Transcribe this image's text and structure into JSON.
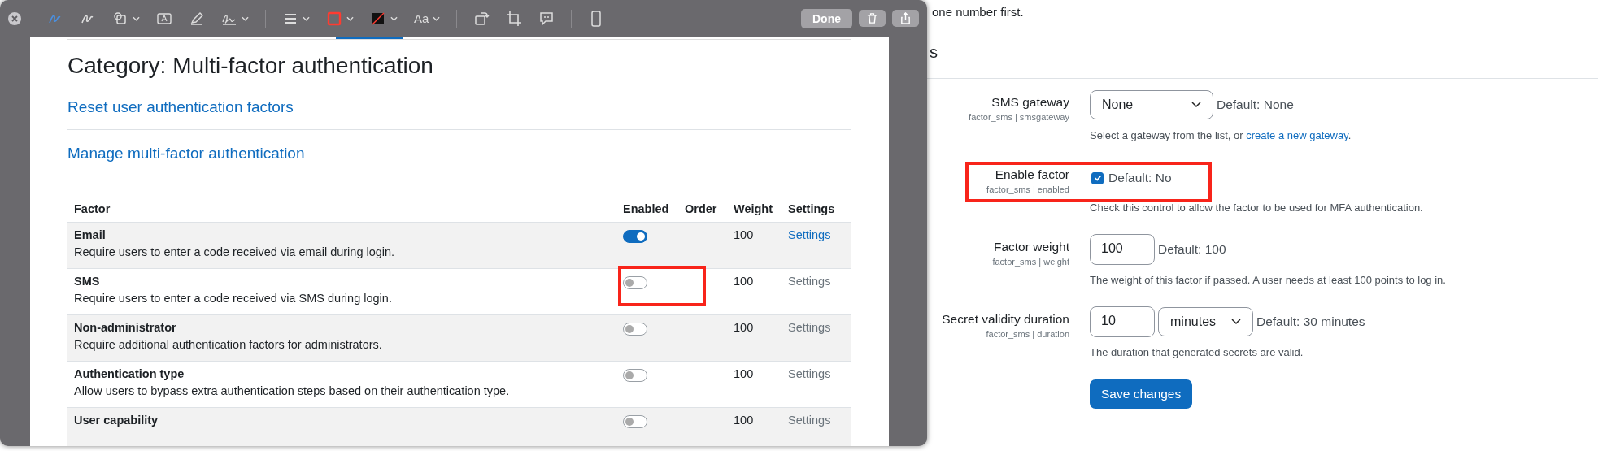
{
  "markup_window": {
    "toolbar": {
      "text_style_label": "Aa",
      "done_button": "Done"
    },
    "page": {
      "title": "Category: Multi-factor authentication",
      "links": [
        "Reset user authentication factors",
        "Manage multi-factor authentication"
      ],
      "table": {
        "columns": [
          "Factor",
          "Enabled",
          "Order",
          "Weight",
          "Settings"
        ],
        "rows": [
          {
            "name": "Email",
            "description": "Require users to enter a code received via email during login.",
            "enabled": true,
            "weight": "100",
            "settings": "Settings"
          },
          {
            "name": "SMS",
            "description": "Require users to enter a code received via SMS during login.",
            "enabled": false,
            "weight": "100",
            "settings": "Settings"
          },
          {
            "name": "Non-administrator",
            "description": "Require additional authentication factors for administrators.",
            "enabled": false,
            "weight": "100",
            "settings": "Settings"
          },
          {
            "name": "Authentication type",
            "description": "Allow users to bypass extra authentication steps based on their authentication type.",
            "enabled": false,
            "weight": "100",
            "settings": "Settings"
          },
          {
            "name": "User capability",
            "enabled": false,
            "weight": "100",
            "settings": "Settings"
          }
        ]
      }
    }
  },
  "background_page": {
    "intro_text": "one number first.",
    "heading": "s",
    "settings": [
      {
        "kind": "select",
        "label": "SMS gateway",
        "setting_id": "factor_sms | smsgateway",
        "value": "None",
        "default": "Default: None",
        "help": "Select a gateway from the list, or ",
        "help_link": "create a new gateway",
        "help_end": "."
      },
      {
        "kind": "checkbox",
        "label": "Enable factor",
        "setting_id": "factor_sms | enabled",
        "checked": true,
        "default": "Default: No",
        "help": "Check this control to allow the factor to be used for MFA authentication."
      },
      {
        "kind": "text",
        "label": "Factor weight",
        "setting_id": "factor_sms | weight",
        "value": "100",
        "default": "Default: 100",
        "help": "The weight of this factor if passed. A user needs at least 100 points to log in."
      },
      {
        "kind": "duration",
        "label": "Secret validity duration",
        "setting_id": "factor_sms | duration",
        "value": "10",
        "unit": "minutes",
        "default": "Default: 30 minutes",
        "help": "The duration that generated secrets are valid."
      }
    ],
    "save_button": "Save changes"
  }
}
